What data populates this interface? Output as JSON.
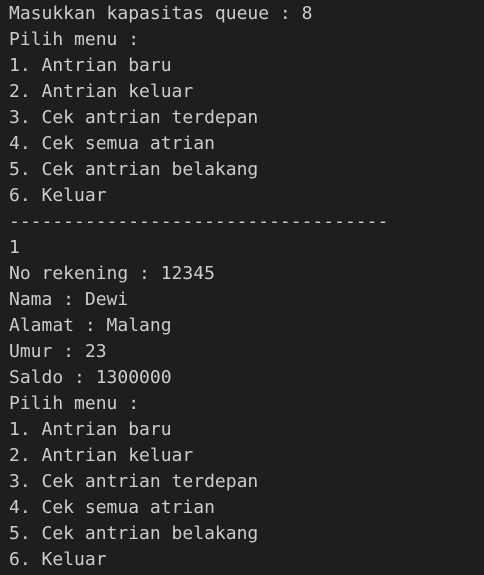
{
  "terminal": {
    "lines": [
      "Masukkan kapasitas queue : 8",
      "Pilih menu :",
      "1. Antrian baru",
      "2. Antrian keluar",
      "3. Cek antrian terdepan",
      "4. Cek semua atrian",
      "5. Cek antrian belakang",
      "6. Keluar",
      "-----------------------------------",
      "1",
      "No rekening : 12345",
      "Nama : Dewi",
      "Alamat : Malang",
      "Umur : 23",
      "Saldo : 1300000",
      "Pilih menu :",
      "1. Antrian baru",
      "2. Antrian keluar",
      "3. Cek antrian terdepan",
      "4. Cek semua atrian",
      "5. Cek antrian belakang",
      "6. Keluar"
    ]
  },
  "colors": {
    "background": "#1e1e1e",
    "text": "#cccccc"
  }
}
